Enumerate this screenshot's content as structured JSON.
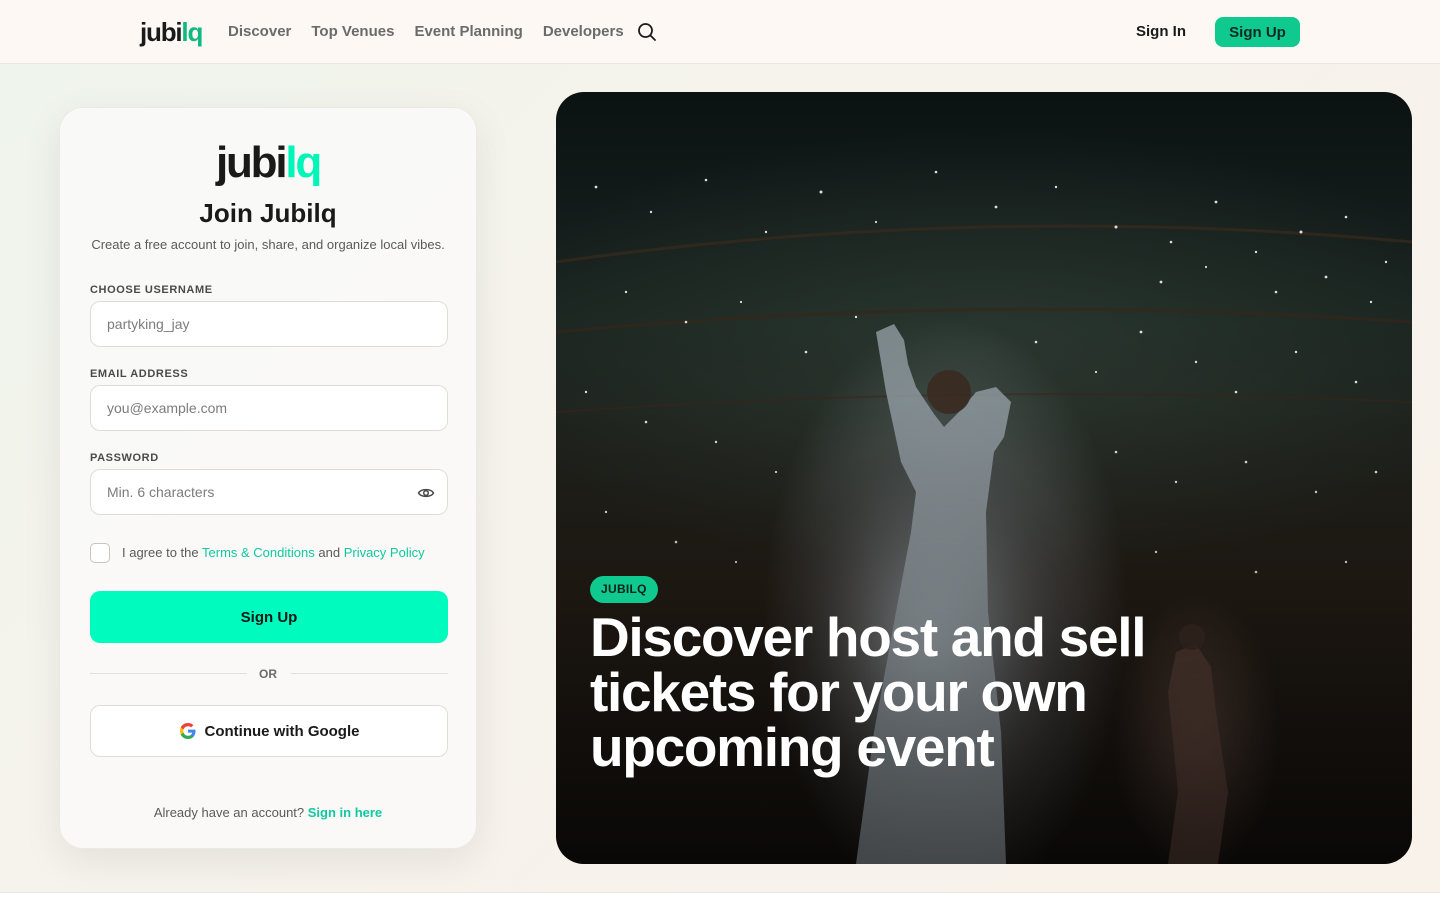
{
  "nav": {
    "logo_main": "jubi",
    "logo_accent": "lq",
    "links": [
      "Discover",
      "Top Venues",
      "Event Planning",
      "Developers"
    ],
    "search_icon": "search-icon",
    "signin_label": "Sign In",
    "signup_label": "Sign Up"
  },
  "card": {
    "logo_main": "jubi",
    "logo_accent": "lq",
    "title": "Join Jubilq",
    "subtitle": "Create a free account to join, share, and organize local vibes.",
    "username": {
      "label": "CHOOSE USERNAME",
      "placeholder": "partyking_jay",
      "value": ""
    },
    "email": {
      "label": "EMAIL ADDRESS",
      "placeholder": "you@example.com",
      "value": ""
    },
    "password": {
      "label": "PASSWORD",
      "placeholder": "Min. 6 characters",
      "value": "",
      "toggle_icon": "eye-icon"
    },
    "agree": {
      "prefix": "I agree to the",
      "terms": "Terms & Conditions",
      "and": "and",
      "privacy": "Privacy Policy",
      "checked": false
    },
    "submit_label": "Sign Up",
    "or_label": "OR",
    "google_label": "Continue with Google",
    "google_icon": "google-icon",
    "already_prefix": "Already have an account?",
    "signin_link": "Sign in here"
  },
  "hero": {
    "badge": "JUBILQ",
    "headline": "Discover host and sell tickets for your own upcoming event"
  },
  "colors": {
    "accent_nav": "#10c98f",
    "accent_bright": "#00fbbf",
    "link": "#10c9a0"
  }
}
